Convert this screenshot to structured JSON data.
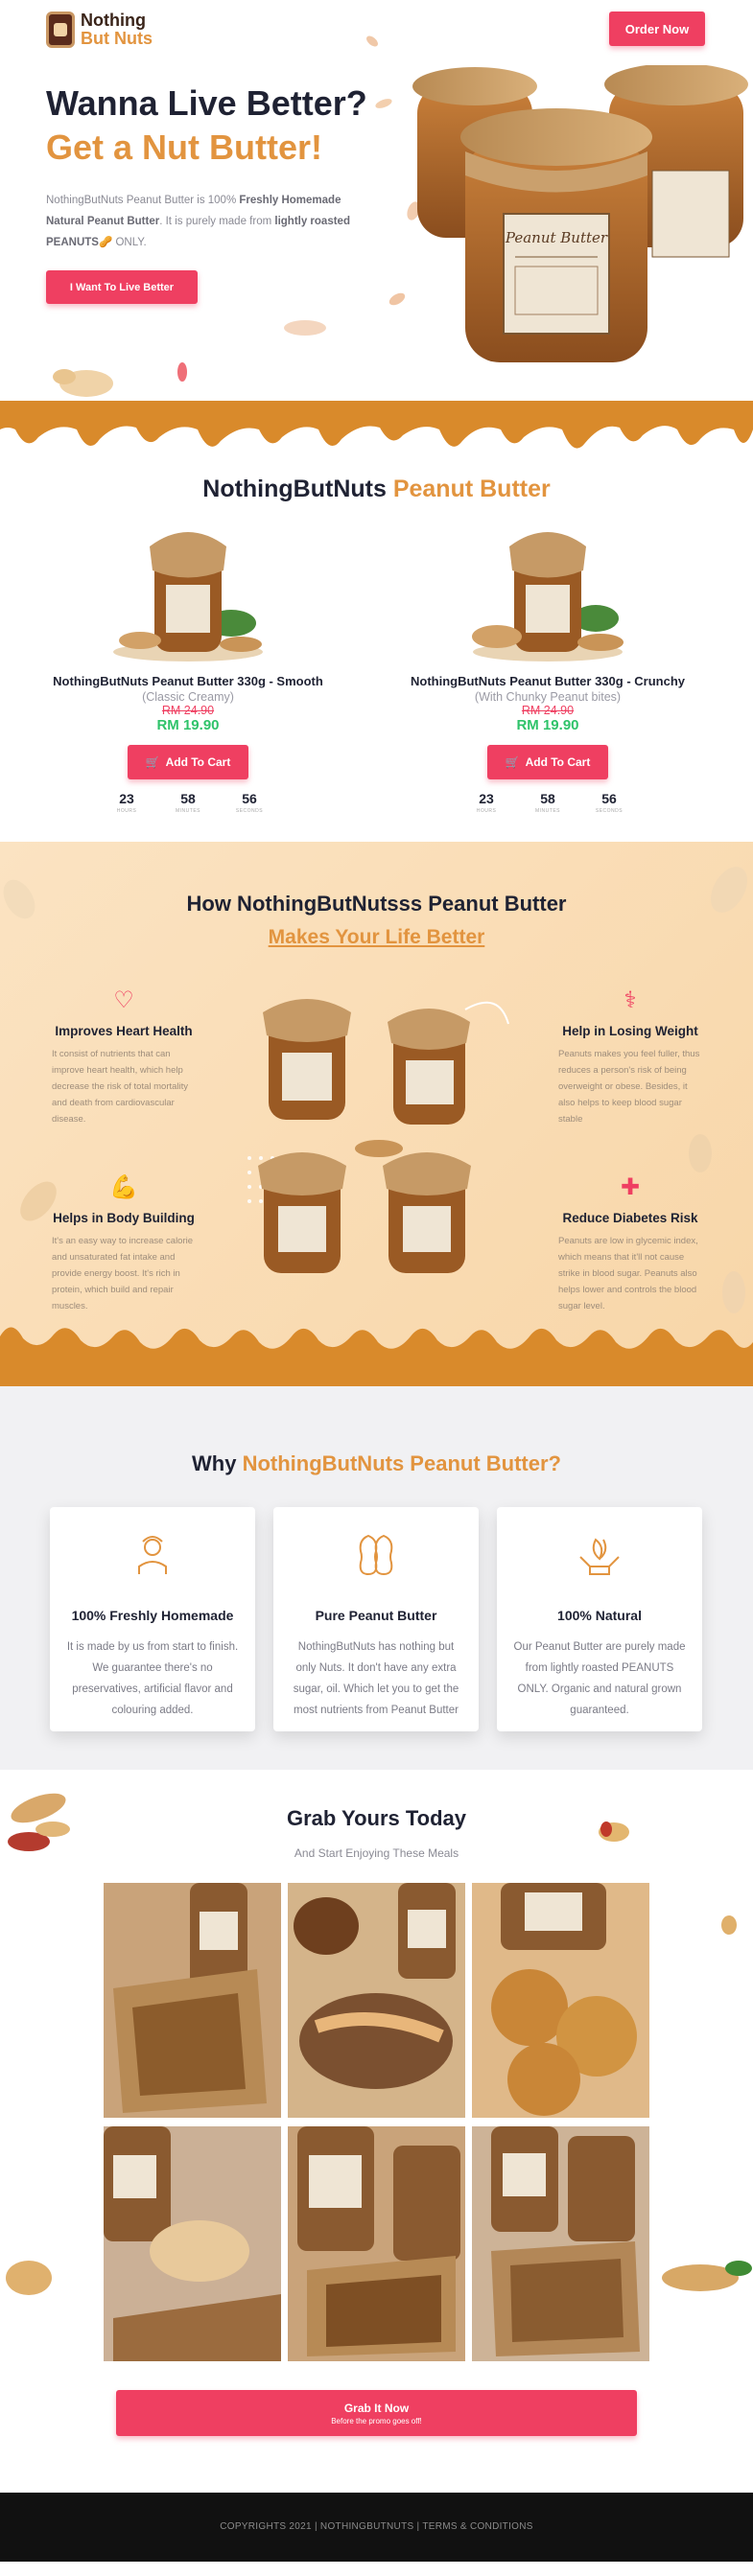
{
  "brand": {
    "line1": "Nothing",
    "line2": "But Nuts"
  },
  "header": {
    "order_button": "Order Now"
  },
  "hero": {
    "title": "Wanna Live Better?",
    "subtitle": "Get a Nut Butter!",
    "desc_1": "NothingButNuts Peanut Butter is 100% ",
    "desc_2": "Freshly Homemade Natural Peanut Butter",
    "desc_3": ". It is purely made from ",
    "desc_4": "lightly roasted",
    "desc_5": "PEANUTS",
    "desc_6": " ONLY.",
    "cta": "I Want To Live Better"
  },
  "products": {
    "title_1": "NothingButNuts ",
    "title_2": "Peanut Butter",
    "items": [
      {
        "name": "NothingButNuts Peanut Butter 330g - Smooth",
        "variant": "(Classic Creamy)",
        "old_price": "RM 24.90",
        "price": "RM 19.90",
        "button": "Add To Cart"
      },
      {
        "name": "NothingButNuts Peanut Butter 330g - Crunchy",
        "variant": "(With Chunky Peanut bites)",
        "old_price": "RM 24.90",
        "price": "RM 19.90",
        "button": "Add To Cart"
      }
    ],
    "timer": [
      {
        "value": "23",
        "unit": "HOURS"
      },
      {
        "value": "58",
        "unit": "MINUTES"
      },
      {
        "value": "56",
        "unit": "SECONDS"
      }
    ]
  },
  "benefits": {
    "title": "How NothingButNutsss Peanut Butter",
    "subtitle": "Makes Your Life Better",
    "items": [
      {
        "icon": "heart-pulse-icon",
        "title": "Improves Heart Health",
        "text": "It consist of nutrients that can improve heart health, which help decrease the risk of total mortality and death from cardiovascular disease."
      },
      {
        "icon": "muscle-arm-icon",
        "title": "Helps in Body Building",
        "text": "It's an easy way to increase calorie and unsaturated fat intake and provide energy boost. It's rich in protein, which build and repair muscles."
      },
      {
        "icon": "weight-loss-icon",
        "title": "Help in Losing Weight",
        "text": "Peanuts makes you feel fuller, thus reduces a person's risk of being overweight or obese. Besides, it also helps to keep blood sugar stable"
      },
      {
        "icon": "blood-sugar-icon",
        "title": "Reduce Diabetes Risk",
        "text": "Peanuts are low in glycemic index, which means that it'll not cause strike in blood sugar. Peanuts also helps lower and controls the blood sugar level."
      }
    ]
  },
  "why": {
    "title_1": "Why ",
    "title_2": "NothingButNuts Peanut Butter?",
    "cards": [
      {
        "icon": "chef-icon",
        "title": "100% Freshly Homemade",
        "text": "It is made by us from start to finish. We guarantee there's no preservatives, artificial flavor and colouring added."
      },
      {
        "icon": "peanut-icon",
        "title": "Pure Peanut Butter",
        "text": "NothingButNuts has nothing but only Nuts. It don't have any extra sugar, oil. Which let you to get the most nutrients from Peanut Butter"
      },
      {
        "icon": "leaf-hands-icon",
        "title": "100% Natural",
        "text": "Our Peanut Butter are purely made from lightly roasted PEANUTS ONLY. Organic and natural grown guaranteed."
      }
    ]
  },
  "gallery": {
    "title": "Grab Yours Today",
    "subtitle": "And Start Enjoying These Meals",
    "button": "Grab It Now",
    "button_sub": "Before the promo goes off!"
  },
  "footer": {
    "text": "COPYRIGHTS 2021 | NOTHINGBUTNUTS | TERMS & CONDITIONS"
  },
  "colors": {
    "accent": "#ef3f61",
    "brand_orange": "#e2943f",
    "price_green": "#2fc36a",
    "caramel": "#d98a2b"
  }
}
